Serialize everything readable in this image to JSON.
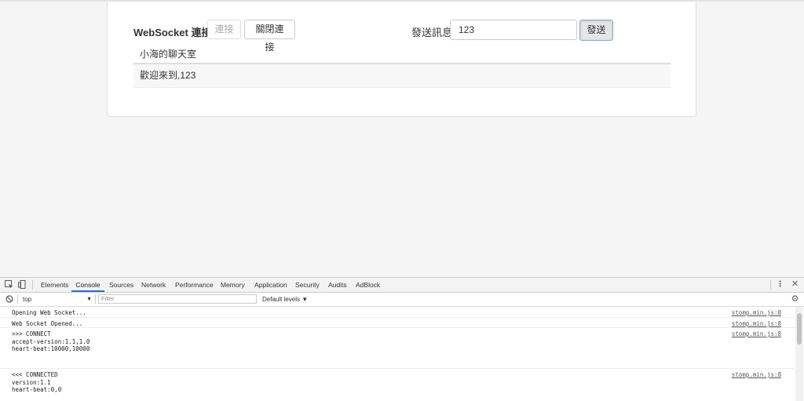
{
  "page": {
    "ws_label": "WebSocket 連接:",
    "connect_label": "連接",
    "disconnect_label": "關閉連接",
    "message_label": "發送訊息",
    "message_value": "123",
    "send_label": "發送",
    "room_title": "小海的聊天室",
    "messages": [
      "歡迎來到,123"
    ]
  },
  "devtools": {
    "tabs": [
      "Elements",
      "Console",
      "Sources",
      "Network",
      "Performance",
      "Memory",
      "Application",
      "Security",
      "Audits",
      "AdBlock"
    ],
    "active_tab": "Console",
    "context": "top",
    "filter_placeholder": "Filter",
    "levels": "Default levels ▼",
    "logs": [
      {
        "text": "Opening Web Socket...",
        "source": "stomp.min.js:8"
      },
      {
        "text": "Web Socket Opened...",
        "source": "stomp.min.js:8"
      },
      {
        "text": ">>> CONNECT\naccept-version:1.1,1.0\nheart-beat:10000,10000",
        "source": "stomp.min.js:8"
      },
      {
        "text": "<<< CONNECTED\nversion:1.1\nheart-beat:0,0",
        "source": "stomp.min.js:8"
      }
    ]
  }
}
